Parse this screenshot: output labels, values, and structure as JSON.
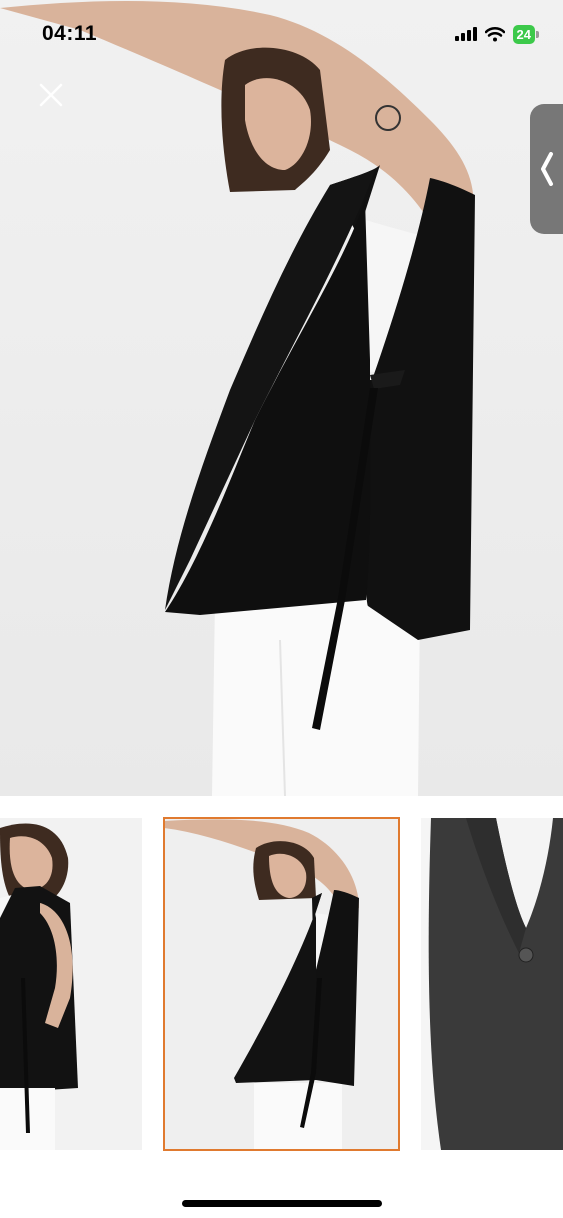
{
  "status_bar": {
    "time": "04:11",
    "battery_level": "24",
    "battery_color": "#3cc94a"
  },
  "icons": {
    "close": "close-icon",
    "side_tab": "chevron-left-icon",
    "signal": "cellular-signal-icon",
    "wifi": "wifi-icon",
    "battery": "battery-charging-icon"
  },
  "gallery": {
    "selected_thumbnail": 2,
    "thumbnail_count": 3,
    "accent_color": "#e07a2f"
  }
}
